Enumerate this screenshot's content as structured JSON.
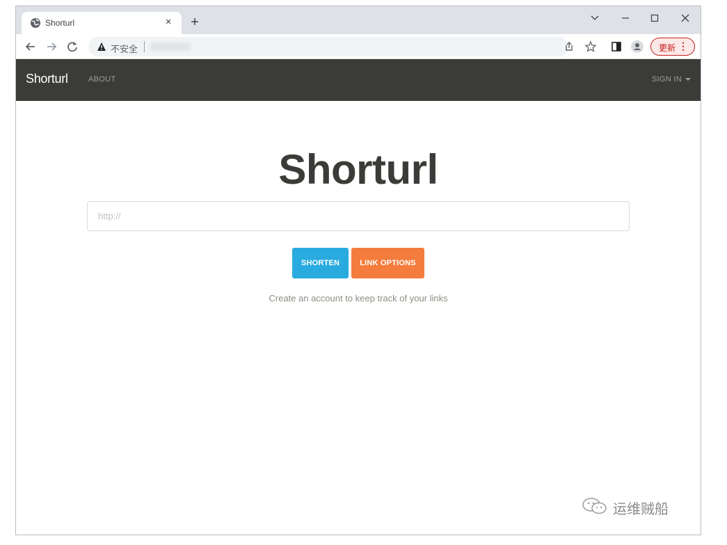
{
  "browser": {
    "tab_title": "Shorturl",
    "tab_close": "×",
    "new_tab": "+",
    "address_warning": "不安全",
    "update_label": "更新",
    "update_menu": "⋮"
  },
  "navbar": {
    "brand": "Shorturl",
    "about": "ABOUT",
    "signin": "SIGN IN"
  },
  "main": {
    "title": "Shorturl",
    "url_placeholder": "http://",
    "url_value": "",
    "shorten_label": "SHORTEN",
    "options_label": "LINK OPTIONS",
    "helper_text": "Create an account to keep track of your links"
  },
  "watermark": {
    "text": "运维贼船"
  },
  "colors": {
    "navbar_bg": "#3b3b38",
    "shorten_btn": "#29abe0",
    "options_btn": "#f47c3c",
    "update_btn": "#c5221f"
  },
  "icons": {
    "favicon": "globe-icon",
    "warning": "warning-triangle-icon",
    "share": "share-icon",
    "bookmark": "star-icon",
    "side_panel": "side-panel-icon",
    "profile": "profile-icon",
    "watermark": "wechat-icon"
  }
}
